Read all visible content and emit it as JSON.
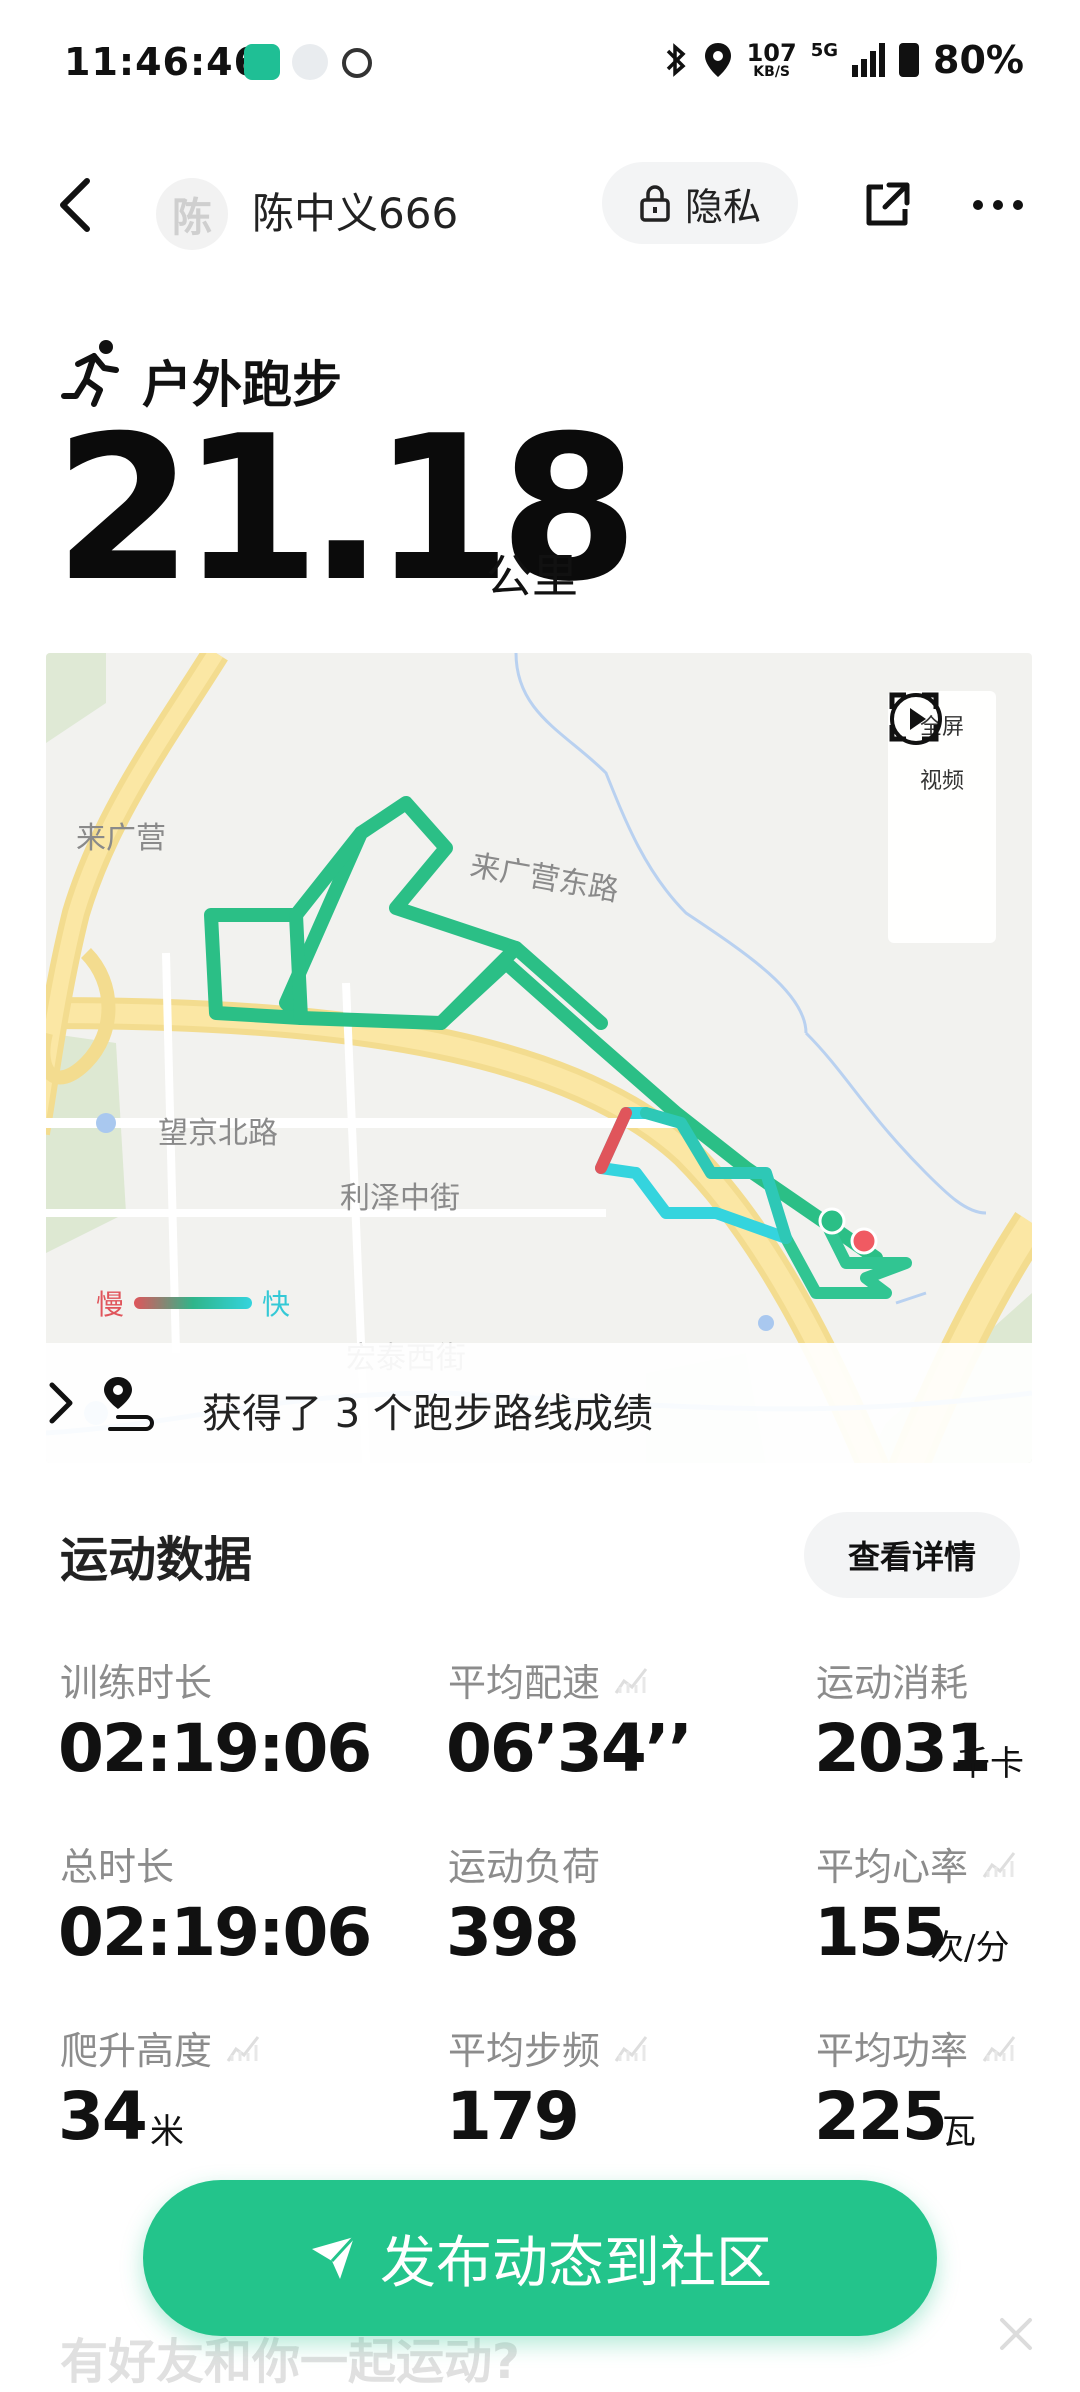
{
  "status_bar": {
    "time": "11:46:46",
    "net_speed_value": "107",
    "net_speed_unit": "KB/S",
    "network_type": "5G",
    "battery": "80%"
  },
  "header": {
    "avatar_text": "陈",
    "username": "陈中义666",
    "privacy_label": "隐私"
  },
  "workout": {
    "sport_type": "户外跑步",
    "distance": "21.18",
    "distance_unit": "公里"
  },
  "map": {
    "labels": [
      "来广营",
      "来广营东路",
      "望京北路",
      "利泽中街",
      "宏泰西街"
    ],
    "fullscreen_label": "全屏",
    "video_label": "视频",
    "speed_slow": "慢",
    "speed_fast": "快",
    "route_achievement": "获得了 3 个跑步路线成绩",
    "colors": {
      "route": "#2bbf86",
      "fast_segment": "#34d4de",
      "slow_segment": "#e0555b",
      "start_dot": "#2bbf86",
      "end_dot": "#f05a62"
    }
  },
  "stats": {
    "title": "运动数据",
    "details_label": "查看详情",
    "items": [
      {
        "label": "训练时长",
        "value": "02:19:06",
        "unit": ""
      },
      {
        "label": "平均配速",
        "value": "06’34’’",
        "unit": ""
      },
      {
        "label": "运动消耗",
        "value": "2031",
        "unit": "千卡"
      },
      {
        "label": "总时长",
        "value": "02:19:06",
        "unit": ""
      },
      {
        "label": "运动负荷",
        "value": "398",
        "unit": ""
      },
      {
        "label": "平均心率",
        "value": "155",
        "unit": "次/分"
      },
      {
        "label": "爬升高度",
        "value": "34",
        "unit": "米"
      },
      {
        "label": "平均步频",
        "value": "179",
        "unit": ""
      },
      {
        "label": "平均功率",
        "value": "225",
        "unit": "瓦"
      }
    ]
  },
  "bottom": {
    "publish_label": "发布动态到社区",
    "friends_prompt": "有好友和你一起运动?",
    "accent_color": "#23c48b"
  }
}
